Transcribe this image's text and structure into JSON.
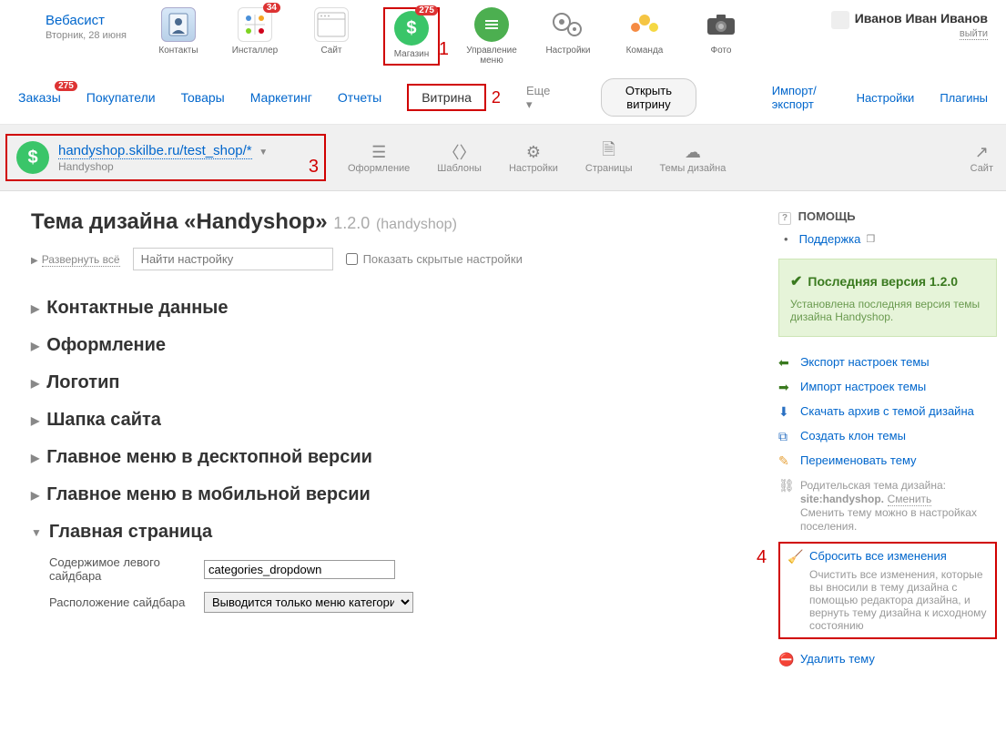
{
  "header": {
    "brand": "Вебасист",
    "date": "Вторник, 28 июня",
    "user": {
      "name": "Иванов Иван Иванов",
      "logout": "выйти"
    },
    "apps": [
      {
        "label": "Контакты",
        "badge": ""
      },
      {
        "label": "Инсталлер",
        "badge": "34"
      },
      {
        "label": "Сайт",
        "badge": ""
      },
      {
        "label": "Магазин",
        "badge": "275"
      },
      {
        "label": "Управление меню",
        "badge": ""
      },
      {
        "label": "Настройки",
        "badge": ""
      },
      {
        "label": "Команда",
        "badge": ""
      },
      {
        "label": "Фото",
        "badge": ""
      }
    ]
  },
  "menu2": {
    "items": [
      "Заказы",
      "Покупатели",
      "Товары",
      "Маркетинг",
      "Отчеты",
      "Витрина"
    ],
    "orders_badge": "275",
    "more": "Еще",
    "open": "Открыть витрину",
    "right": [
      "Импорт/экспорт",
      "Настройки",
      "Плагины"
    ]
  },
  "toolbar3": {
    "url": "handyshop.skilbe.ru/test_shop/*",
    "name": "Handyshop",
    "items": [
      "Оформление",
      "Шаблоны",
      "Настройки",
      "Страницы",
      "Темы дизайна"
    ],
    "site": "Сайт"
  },
  "page": {
    "title_pre": "Тема дизайна «",
    "title_name": "Handyshop",
    "title_post": "»",
    "version": "1.2.0",
    "slug": "(handyshop)",
    "expand": "Развернуть всё",
    "search_ph": "Найти настройку",
    "show_hidden": "Показать скрытые настройки"
  },
  "sections": [
    "Контактные данные",
    "Оформление",
    "Логотип",
    "Шапка сайта",
    "Главное меню в десктопной версии",
    "Главное меню в мобильной версии",
    "Главная страница"
  ],
  "home": {
    "f1_label": "Содержимое левого сайдбара",
    "f1_value": "categories_dropdown",
    "f2_label": "Расположение сайдбара",
    "f2_value": "Выводится только меню категорий"
  },
  "sidebar": {
    "help": "ПОМОЩЬ",
    "support": "Поддержка",
    "ver_h": "Последняя версия 1.2.0",
    "ver_t": "Установлена последняя версия темы дизайна Handyshop.",
    "actions": {
      "export": "Экспорт настроек темы",
      "import": "Импорт настроек темы",
      "download": "Скачать архив с темой дизайна",
      "clone": "Создать клон темы",
      "rename": "Переименовать тему",
      "parent_l1": "Родительская тема дизайна:",
      "parent_l2": "site:handyshop.",
      "parent_change": "Сменить",
      "parent_l3": "Сменить тему можно в настройках поселения.",
      "reset": "Сбросить все изменения",
      "reset_t": "Очистить все изменения, которые вы вносили в тему дизайна с помощью редактора дизайна, и вернуть тему дизайна к исходному состоянию",
      "delete": "Удалить тему"
    }
  },
  "annotations": {
    "a1": "1",
    "a2": "2",
    "a3": "3",
    "a4": "4"
  }
}
